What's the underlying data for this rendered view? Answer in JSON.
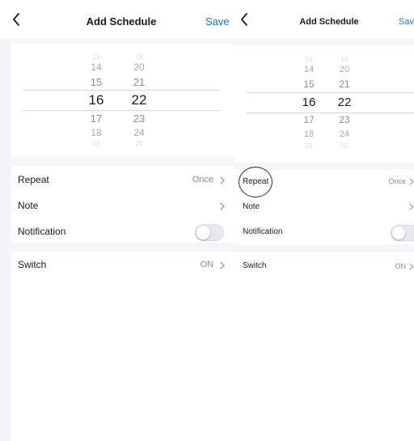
{
  "screens": [
    {
      "title": "Add Schedule",
      "save": "Save",
      "hours": [
        "13",
        "14",
        "15",
        "16",
        "17",
        "18",
        "19"
      ],
      "minutes": [
        "19",
        "20",
        "21",
        "22",
        "23",
        "24",
        "25"
      ],
      "rows": {
        "repeat": {
          "label": "Repeat",
          "value": "Once"
        },
        "note": {
          "label": "Note"
        },
        "notification": {
          "label": "Notification",
          "enabled": false
        },
        "switch": {
          "label": "Switch",
          "value": "ON"
        }
      }
    },
    {
      "title": "Add Schedule",
      "save": "Save",
      "hours": [
        "13",
        "14",
        "15",
        "16",
        "17",
        "18",
        "19"
      ],
      "minutes": [
        "19",
        "20",
        "21",
        "22",
        "23",
        "24",
        "25"
      ],
      "rows": {
        "repeat": {
          "label": "Repeat",
          "value": "Once"
        },
        "note": {
          "label": "Note"
        },
        "notification": {
          "label": "Notification",
          "enabled": false
        },
        "switch": {
          "label": "Switch",
          "value": "ON"
        }
      }
    }
  ],
  "selected_time": {
    "hour": "16",
    "minute": "22"
  },
  "colors": {
    "accent": "#1a73e8",
    "page_bg": "#f4f5f9",
    "divider": "#d8d8d8"
  },
  "icons": {
    "back": "chevron-left-icon",
    "row_arrow": "chevron-right-icon"
  }
}
